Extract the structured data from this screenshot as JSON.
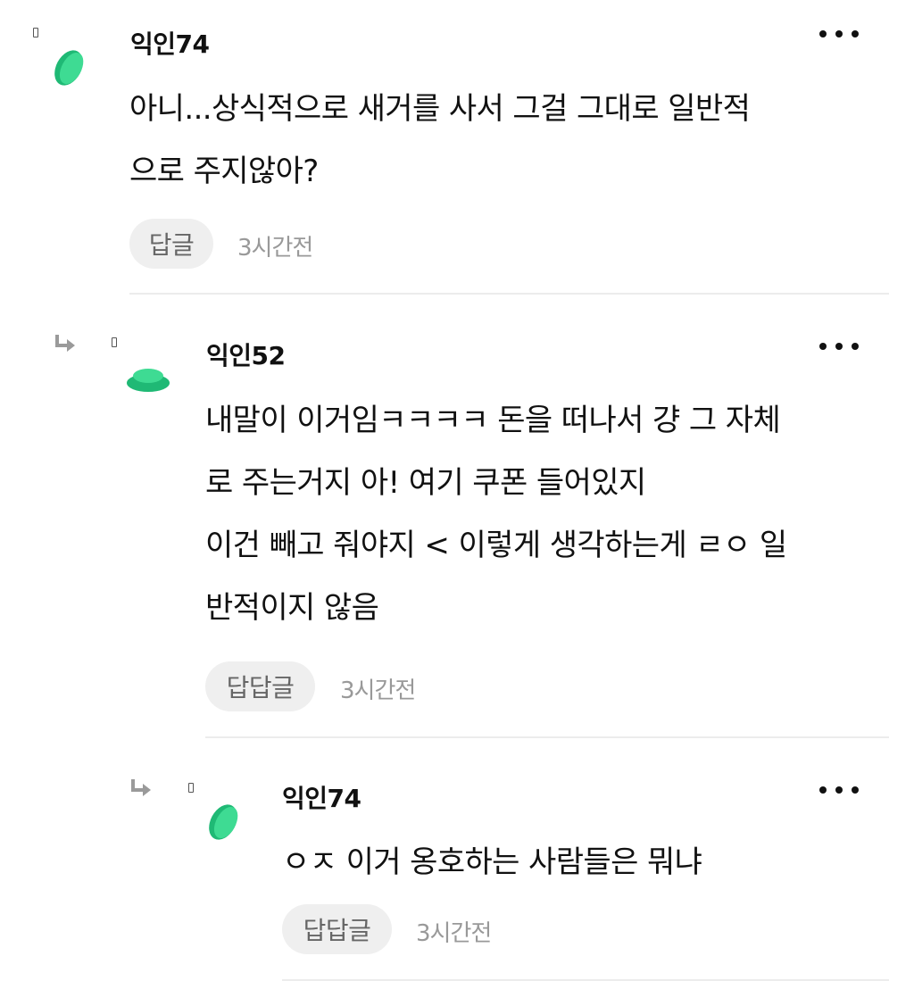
{
  "comments": [
    {
      "nickname": "익인74",
      "lines": [
        "아니...상식적으로 새거를 사서 그걸 그대로 일반적",
        "으로 주지않아?"
      ],
      "reply_label": "답글",
      "time": "3시간전"
    },
    {
      "nickname": "익인52",
      "lines": [
        "내말이 이거임ㅋㅋㅋㅋ 돈을 떠나서 걍 그 자체",
        "로 주는거지 아! 여기 쿠폰 들어있지",
        "이건 빼고 줘야지 < 이렇게 생각하는게 ㄹㅇ 일",
        "반적이지 않음"
      ],
      "reply_label": "답답글",
      "time": "3시간전"
    },
    {
      "nickname": "익인74",
      "lines": [
        "ㅇㅈ 이거 옹호하는 사람들은 뭐냐"
      ],
      "reply_label": "답답글",
      "time": "3시간전"
    }
  ],
  "icons": {
    "more": "more-horizontal-icon",
    "reply_indent": "reply-arrow-icon",
    "avatar": "green-avatar-icon"
  },
  "colors": {
    "avatar_green": "#22c07a",
    "avatar_green_light": "#4ee29c",
    "reply_button_bg": "#efefef",
    "divider": "#ececec",
    "muted_text": "#999999"
  }
}
